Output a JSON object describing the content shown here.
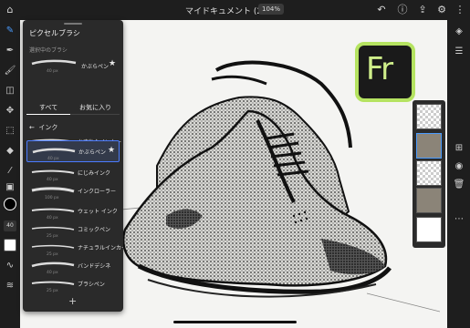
{
  "app": {
    "document_title": "マイドキュメント (2)",
    "zoom": "104%"
  },
  "colors": {
    "accent": "#4b9cff",
    "logo_border": "#b5e361",
    "panel_bg": "#2a2a2a"
  },
  "top_bar": {
    "icons": [
      "undo-icon",
      "help-icon",
      "share-icon",
      "settings-icon"
    ]
  },
  "left_toolbar": {
    "tools": [
      "pixel-brush-icon",
      "vector-brush-icon",
      "live-brush-icon",
      "eraser-icon",
      "move-icon",
      "select-icon",
      "fill-icon",
      "eyedropper-icon",
      "image-icon"
    ],
    "current_color": "#000000",
    "brush_size_label": "40"
  },
  "brush_panel": {
    "title": "ピクセルブラシ",
    "selected_section_label": "選択中のブラシ",
    "selected_brush": {
      "name": "かぶらペン",
      "size": "40 px"
    },
    "tabs": [
      "すべて",
      "お気に入り"
    ],
    "category": "インク",
    "brushes": [
      {
        "name": "かすれたインカー",
        "size": "40 px"
      },
      {
        "name": "かぶらペン",
        "size": "40 px",
        "selected": true
      },
      {
        "name": "にじみインク",
        "size": "40 px"
      },
      {
        "name": "インクローラー",
        "size": "100 px"
      },
      {
        "name": "ウェット インク",
        "size": "40 px"
      },
      {
        "name": "コミックペン",
        "size": "25 px"
      },
      {
        "name": "ナチュラルインカー",
        "size": "25 px"
      },
      {
        "name": "バンドデシネ",
        "size": "40 px"
      },
      {
        "name": "ブラシペン",
        "size": "25 px"
      }
    ],
    "add_label": "+"
  },
  "logo": {
    "text": "Fr"
  },
  "right_toolbar": {
    "icons": [
      "layers-icon",
      "layer-properties-icon",
      "add-layer-icon",
      "visibility-icon",
      "delete-icon",
      "more-icon"
    ]
  }
}
